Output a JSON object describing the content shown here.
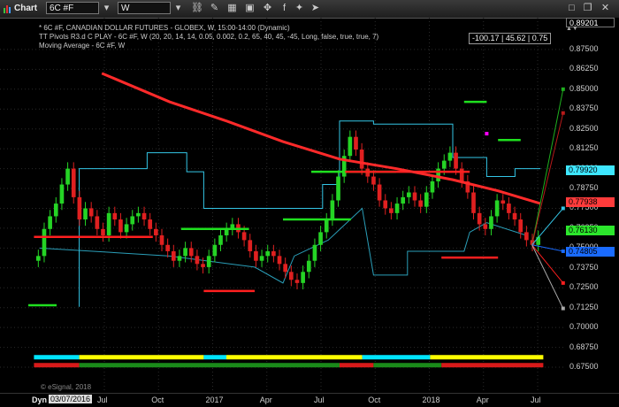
{
  "toolbar": {
    "chart_label": "Chart",
    "symbol_value": "6C #F",
    "interval_value": "W"
  },
  "legend": {
    "line1": "* 6C #F, CANADIAN DOLLAR FUTURES - GLOBEX, W, 15:00-14:00 (Dynamic)",
    "line2": "TT Pivots R3.d C PLAY - 6C #F, W (20, 20, 14, 14, 0.05, 0.002, 0.2, 65, 40, 45, -45, Long, false, true, true, 7)",
    "line3": "Moving Average - 6C #F, W"
  },
  "readout": "-100.17 | 45.62 | 0.75",
  "price_axis": {
    "top_tag": "0.89201",
    "ticks": [
      "0.87500",
      "0.86250",
      "0.85000",
      "0.83750",
      "0.82500",
      "0.81250",
      "0.80000",
      "0.78750",
      "0.77500",
      "0.76250",
      "0.75000",
      "0.73750",
      "0.72500",
      "0.71250",
      "0.70000",
      "0.68750",
      "0.67500"
    ],
    "tags": [
      {
        "text": "0.79920",
        "color": "#3ee6ff",
        "price": 0.7992
      },
      {
        "text": "0.77938",
        "color": "#ff3b3b",
        "price": 0.77938
      },
      {
        "text": "0.76130",
        "color": "#2ce62c",
        "price": 0.7613
      },
      {
        "text": "0.74805",
        "color": "#1a6bff",
        "price": 0.74805
      }
    ]
  },
  "time_axis": {
    "start_label": "Dyn",
    "cursor_date": "03/07/2016",
    "labels": [
      "Jul",
      "Oct",
      "2017",
      "Apr",
      "Jul",
      "Oct",
      "2018",
      "Apr",
      "Jul"
    ]
  },
  "footer_note": "© eSignal, 2018",
  "colors": {
    "ma": "#ff2a2a",
    "pivot_upper": "#34c6e6",
    "candle_up": "#25d425",
    "candle_down": "#e02020",
    "level_green": "#1fe01f",
    "level_red": "#ff1f1f",
    "bar_yellow": "#ffff00",
    "bar_cyan": "#00e5ff",
    "bar_green": "#1a8a1a",
    "bar_red": "#d81a1a"
  },
  "chart_data": {
    "type": "candlestick",
    "symbol": "6C #F",
    "ylim": [
      0.67,
      0.895
    ],
    "x_labels": [
      "Jul",
      "Oct",
      "2017",
      "Apr",
      "Jul",
      "Oct",
      "2018",
      "Apr",
      "Jul"
    ],
    "closes": [
      0.745,
      0.762,
      0.77,
      0.778,
      0.79,
      0.8,
      0.782,
      0.768,
      0.775,
      0.77,
      0.762,
      0.758,
      0.772,
      0.768,
      0.76,
      0.765,
      0.77,
      0.772,
      0.768,
      0.762,
      0.758,
      0.752,
      0.748,
      0.742,
      0.745,
      0.75,
      0.745,
      0.74,
      0.738,
      0.745,
      0.752,
      0.758,
      0.762,
      0.765,
      0.76,
      0.755,
      0.748,
      0.742,
      0.745,
      0.748,
      0.745,
      0.74,
      0.735,
      0.73,
      0.728,
      0.735,
      0.742,
      0.752,
      0.76,
      0.768,
      0.78,
      0.795,
      0.808,
      0.82,
      0.812,
      0.8,
      0.795,
      0.79,
      0.78,
      0.775,
      0.772,
      0.778,
      0.782,
      0.785,
      0.78,
      0.776,
      0.785,
      0.792,
      0.8,
      0.805,
      0.81,
      0.8,
      0.792,
      0.785,
      0.772,
      0.765,
      0.762,
      0.77,
      0.78,
      0.778,
      0.772,
      0.768,
      0.76,
      0.755,
      0.752,
      0.757
    ],
    "moving_average": [
      [
        0.18,
        0.86
      ],
      [
        0.3,
        0.842
      ],
      [
        0.4,
        0.83
      ],
      [
        0.5,
        0.817
      ],
      [
        0.6,
        0.806
      ],
      [
        0.7,
        0.8
      ],
      [
        0.8,
        0.793
      ],
      [
        0.88,
        0.786
      ],
      [
        0.955,
        0.778
      ]
    ],
    "green_levels": [
      [
        0.05,
        0.1,
        0.714
      ],
      [
        0.32,
        0.44,
        0.762
      ],
      [
        0.5,
        0.62,
        0.768
      ],
      [
        0.55,
        0.7,
        0.798
      ],
      [
        0.82,
        0.86,
        0.842
      ],
      [
        0.88,
        0.92,
        0.818
      ]
    ],
    "red_levels": [
      [
        0.06,
        0.27,
        0.757
      ],
      [
        0.36,
        0.45,
        0.723
      ],
      [
        0.61,
        0.83,
        0.798
      ],
      [
        0.78,
        0.88,
        0.744
      ]
    ]
  }
}
